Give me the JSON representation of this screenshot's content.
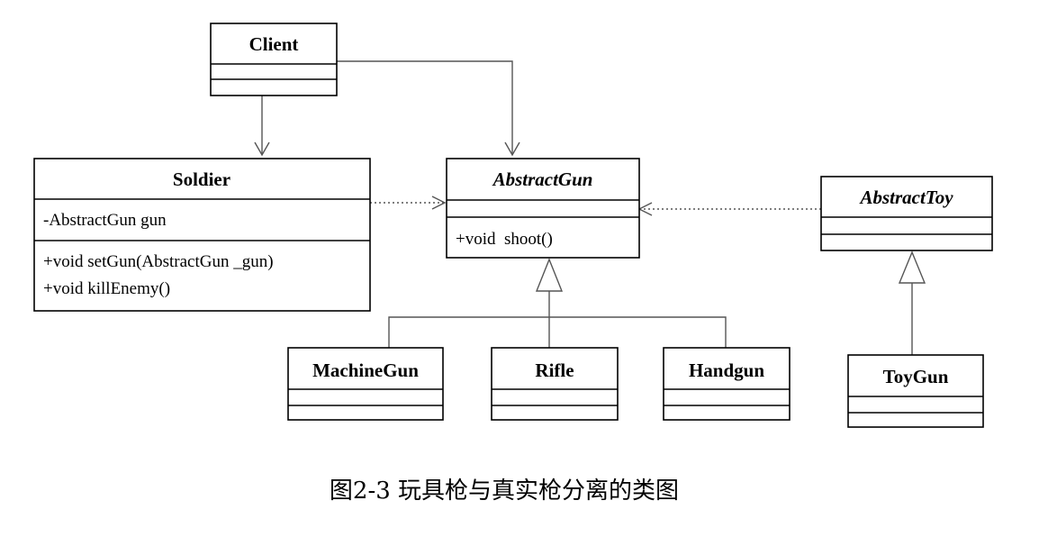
{
  "classes": {
    "client": {
      "name": "Client",
      "attributes": [],
      "methods": []
    },
    "soldier": {
      "name": "Soldier",
      "attributes": [
        "-AbstractGun gun"
      ],
      "methods": [
        "+void setGun(AbstractGun _gun)",
        "+void killEnemy()"
      ]
    },
    "abstract_gun": {
      "name": "AbstractGun",
      "abstract": true,
      "attributes": [],
      "methods": [
        "+void  shoot()"
      ]
    },
    "abstract_toy": {
      "name": "AbstractToy",
      "abstract": true,
      "attributes": [],
      "methods": []
    },
    "machine_gun": {
      "name": "MachineGun",
      "attributes": [],
      "methods": []
    },
    "rifle": {
      "name": "Rifle",
      "attributes": [],
      "methods": []
    },
    "handgun": {
      "name": "Handgun",
      "attributes": [],
      "methods": []
    },
    "toy_gun": {
      "name": "ToyGun",
      "attributes": [],
      "methods": []
    }
  },
  "relationships": [
    {
      "from": "client",
      "to": "soldier",
      "type": "association"
    },
    {
      "from": "client",
      "to": "abstract_gun",
      "type": "association"
    },
    {
      "from": "soldier",
      "to": "abstract_gun",
      "type": "dependency"
    },
    {
      "from": "abstract_toy",
      "to": "abstract_gun",
      "type": "dependency"
    },
    {
      "from": "machine_gun",
      "to": "abstract_gun",
      "type": "generalization"
    },
    {
      "from": "rifle",
      "to": "abstract_gun",
      "type": "generalization"
    },
    {
      "from": "handgun",
      "to": "abstract_gun",
      "type": "generalization"
    },
    {
      "from": "toy_gun",
      "to": "abstract_toy",
      "type": "generalization"
    }
  ],
  "caption": "图2-3 玩具枪与真实枪分离的类图"
}
